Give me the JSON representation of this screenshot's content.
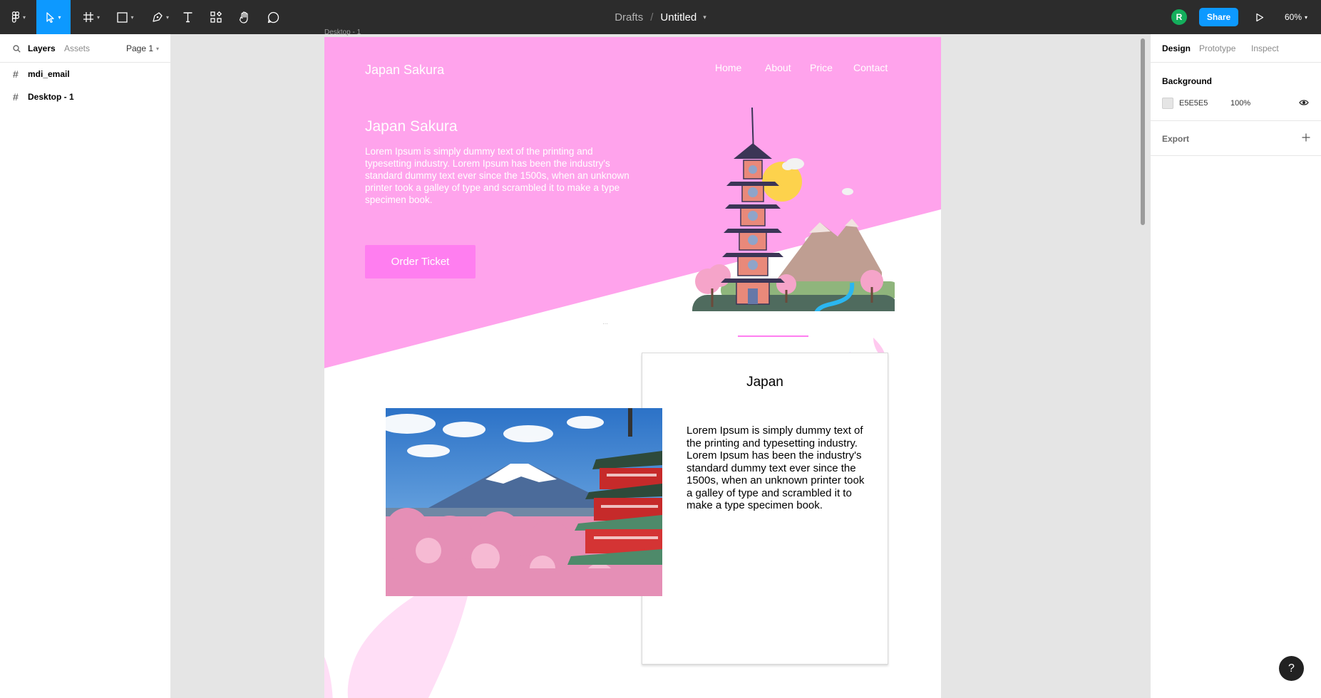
{
  "toolbar": {
    "breadcrumb_parent": "Drafts",
    "breadcrumb_separator": "/",
    "file_title": "Untitled",
    "avatar_initial": "R",
    "share_label": "Share",
    "zoom_level": "60%",
    "icons": [
      "figma-menu-icon",
      "move-tool-icon",
      "frame-tool-icon",
      "shape-tool-icon",
      "pen-tool-icon",
      "text-tool-icon",
      "resources-icon",
      "hand-tool-icon",
      "comment-icon",
      "play-icon"
    ],
    "colors": {
      "bar": "#2c2c2c",
      "accent": "#0d99ff",
      "avatar": "#14ae5c"
    }
  },
  "left_panel": {
    "tabs": {
      "layers": "Layers",
      "assets": "Assets"
    },
    "page_selector": "Page 1",
    "layers": [
      {
        "name": "mdi_email"
      },
      {
        "name": "Desktop - 1"
      }
    ]
  },
  "right_panel": {
    "tabs": {
      "design": "Design",
      "prototype": "Prototype",
      "inspect": "Inspect"
    },
    "background": {
      "title": "Background",
      "hex": "E5E5E5",
      "opacity": "100%"
    },
    "export": {
      "title": "Export"
    },
    "help": "?"
  },
  "canvas": {
    "frame_label": "Desktop - 1",
    "colors": {
      "hero_pink": "#ffa3ec",
      "button_pink": "#ff7ef0"
    },
    "site": {
      "logo": "Japan Sakura",
      "nav": [
        "Home",
        "About",
        "Price",
        "Contact"
      ],
      "hero_title": "Japan Sakura",
      "hero_text": "Lorem Ipsum is simply dummy text of the printing and typesetting industry. Lorem Ipsum has been the industry's standard dummy text ever since the 1500s, when an unknown printer took a galley of type and scrambled it to make a type specimen book.",
      "order_button": "Order  Ticket",
      "card_title": "Japan",
      "card_text": "Lorem Ipsum is simply dummy text of the printing and typesetting industry. Lorem Ipsum has been the industry's standard dummy text ever since the 1500s, when an unknown printer took a galley of type and scrambled it to make a type specimen book."
    }
  }
}
